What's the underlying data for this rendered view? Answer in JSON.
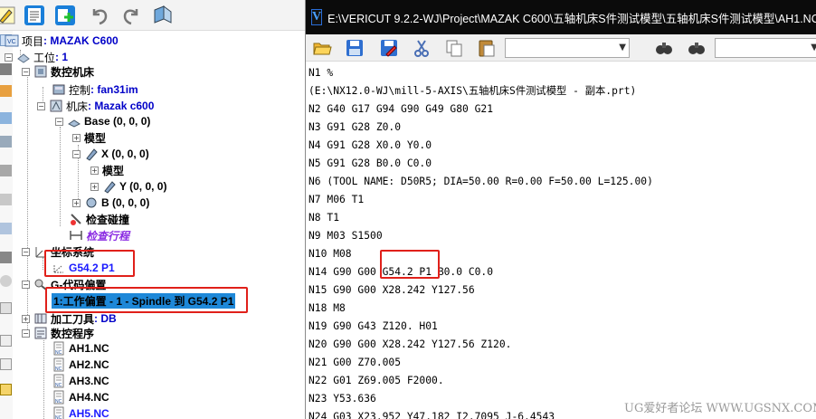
{
  "left_panel": {
    "tree": {
      "project": {
        "label": "项目",
        "value": ": MAZAK C600"
      },
      "station": {
        "label": "工位",
        "value": ": 1"
      },
      "cnc_machine": {
        "label": "数控机床"
      },
      "control": {
        "label": "控制",
        "value": ": fan31im"
      },
      "machine": {
        "label": "机床",
        "value": ": Mazak c600"
      },
      "base": {
        "label": "Base (0, 0, 0)"
      },
      "model1": {
        "label": "模型"
      },
      "x_axis": {
        "label": "X (0, 0, 0)"
      },
      "model2": {
        "label": "模型"
      },
      "y_axis": {
        "label": "Y (0, 0, 0)"
      },
      "b_axis": {
        "label": "B (0, 0, 0)"
      },
      "collision_check": {
        "label": "检查碰撞"
      },
      "travel_check": {
        "label": "检查行程"
      },
      "coord_system": {
        "label": "坐标系统"
      },
      "g54": {
        "label": "G54.2 P1"
      },
      "g_offset": {
        "label": "G-代码偏置"
      },
      "work_offset": {
        "label": "1:工作偏置 - 1 - Spindle 到 G54.2 P1"
      },
      "tooling": {
        "label": "加工刀具",
        "value": ": DB"
      },
      "nc_programs": {
        "label": "数控程序"
      },
      "files": [
        "AH1.NC",
        "AH2.NC",
        "AH3.NC",
        "AH4.NC",
        "AH5.NC"
      ]
    }
  },
  "window": {
    "title": "E:\\VERICUT 9.2.2-WJ\\Project\\MAZAK C600\\五轴机床S件测试模型\\五轴机床S件测试模型\\AH1.NC"
  },
  "code_lines": [
    "N1 %",
    "(E:\\NX12.0-WJ\\mill-5-AXIS\\五轴机床S件测试模型 - 副本.prt)",
    "N2 G40 G17 G94 G90 G49 G80 G21",
    "N3 G91 G28 Z0.0",
    "N4 G91 G28 X0.0 Y0.0",
    "N5 G91 G28 B0.0 C0.0",
    "N6 (TOOL NAME: D50R5; DIA=50.00 R=0.00 F=50.00 L=125.00)",
    "N7 M06 T1",
    "N8 T1",
    "N9 M03 S1500",
    "N10 M08",
    "N14 G90 G00 G54.2 P1 B0.0 C0.0",
    "N15 G90 G00 X28.242 Y127.56",
    "N18 M8",
    "N19 G90 G43 Z120. H01",
    "N20 G90 G00 X28.242 Y127.56 Z120.",
    "N21 G00 Z70.005",
    "N22 G01 Z69.005 F2000.",
    "N23 Y53.636",
    "N24 G03 X23.952 Y47.182 I2.7095 J-6.4543"
  ],
  "watermark": "UG爱好者论坛 WWW.UGSNX.COM",
  "colors": {
    "title_bar": "#0b0b0b",
    "tree_value_blue": "#0000c8",
    "selection": "#1e88d8",
    "highlight_box": "#e0201a",
    "travel_check": "#8a2be2"
  }
}
